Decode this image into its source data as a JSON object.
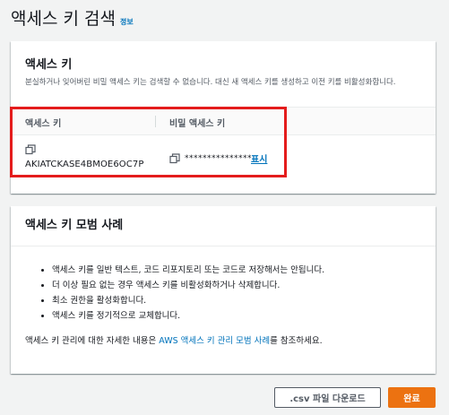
{
  "page": {
    "title": "액세스 키 검색",
    "info_link": "정보"
  },
  "retrieve_card": {
    "title": "액세스 키",
    "description": "분실하거나 잊어버린 비밀 액세스 키는 검색할 수 없습니다. 대신 새 액세스 키를 생성하고 이전 키를 비활성화합니다.",
    "columns": [
      "액세스 키",
      "비밀 액세스 키"
    ],
    "access_key_id": "AKIATCKASE4BMOE6OC7P",
    "secret_masked": "***************",
    "show_label": "표시"
  },
  "best_practices": {
    "title": "액세스 키 모범 사례",
    "items": [
      "액세스 키를 일반 텍스트, 코드 리포지토리 또는 코드로 저장해서는 안됩니다.",
      "더 이상 필요 없는 경우 액세스 키를 비활성화하거나 삭제합니다.",
      "최소 권한을 활성화합니다.",
      "액세스 키를 정기적으로 교체합니다."
    ],
    "reference_prefix": "액세스 키 관리에 대한 자세한 내용은 ",
    "reference_link": "AWS 액세스 키 관리 모범 사례",
    "reference_suffix": "를 참조하세요."
  },
  "footer": {
    "csv_button": ".csv 파일 다운로드",
    "done_button": "완료"
  },
  "colors": {
    "accent": "#ec7211",
    "link": "#0073bb",
    "highlight": "#e41c1c"
  },
  "icons": {
    "copy": "copy-icon"
  }
}
